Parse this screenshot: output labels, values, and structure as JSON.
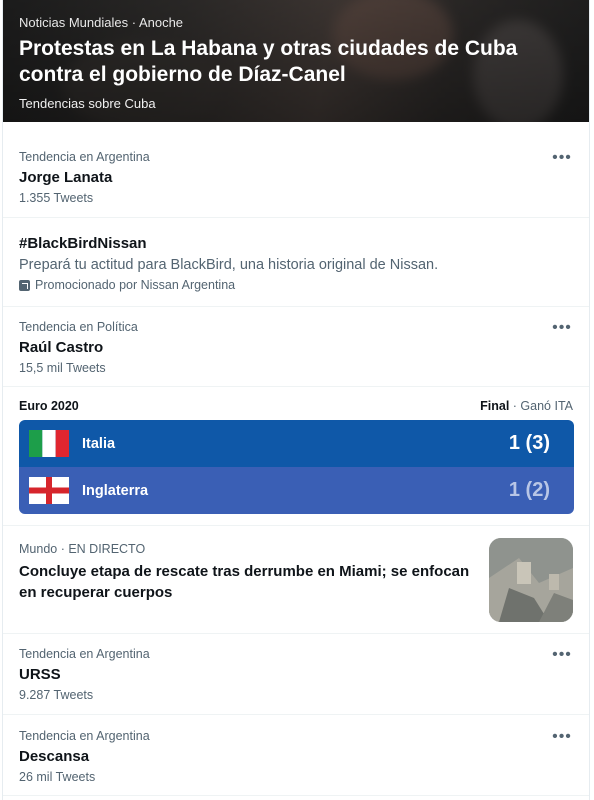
{
  "hero": {
    "meta": "Noticias Mundiales · Anoche",
    "title": "Protestas en La Habana y otras ciudades de Cuba contra el gobierno de Díaz-Canel",
    "subtitle": "Tendencias sobre Cuba"
  },
  "trends": [
    {
      "context": "Tendencia en Argentina",
      "name": "Jorge Lanata",
      "count": "1.355 Tweets"
    },
    {
      "context": "Tendencia en Política",
      "name": "Raúl Castro",
      "count": "15,5 mil Tweets"
    },
    {
      "context": "Tendencia en Argentina",
      "name": "URSS",
      "count": "9.287 Tweets"
    },
    {
      "context": "Tendencia en Argentina",
      "name": "Descansa",
      "count": "26 mil Tweets"
    }
  ],
  "promoted": {
    "name": "#BlackBirdNissan",
    "description": "Prepará tu actitud para BlackBird, una historia original de Nissan.",
    "promoted_by": "Promocionado por Nissan Argentina"
  },
  "euro": {
    "header": "Euro 2020",
    "status_final": "Final",
    "status_rest": " · Ganó ITA",
    "teams": [
      {
        "name": "Italia",
        "score": "1 (3)"
      },
      {
        "name": "Inglaterra",
        "score": "1 (2)"
      }
    ]
  },
  "news": {
    "context": "Mundo · EN DIRECTO",
    "title": "Concluye etapa de rescate tras derrumbe en Miami; se enfocan en recuperar cuerpos"
  },
  "icons": {
    "more": "more-options-icon",
    "promoted": "promoted-icon",
    "flag_italy": "italy-flag-icon",
    "flag_england": "england-flag-icon"
  },
  "colors": {
    "italy_row": "#0f58a8",
    "england_row": "#3a5fb5",
    "secondary_text": "#536471"
  }
}
